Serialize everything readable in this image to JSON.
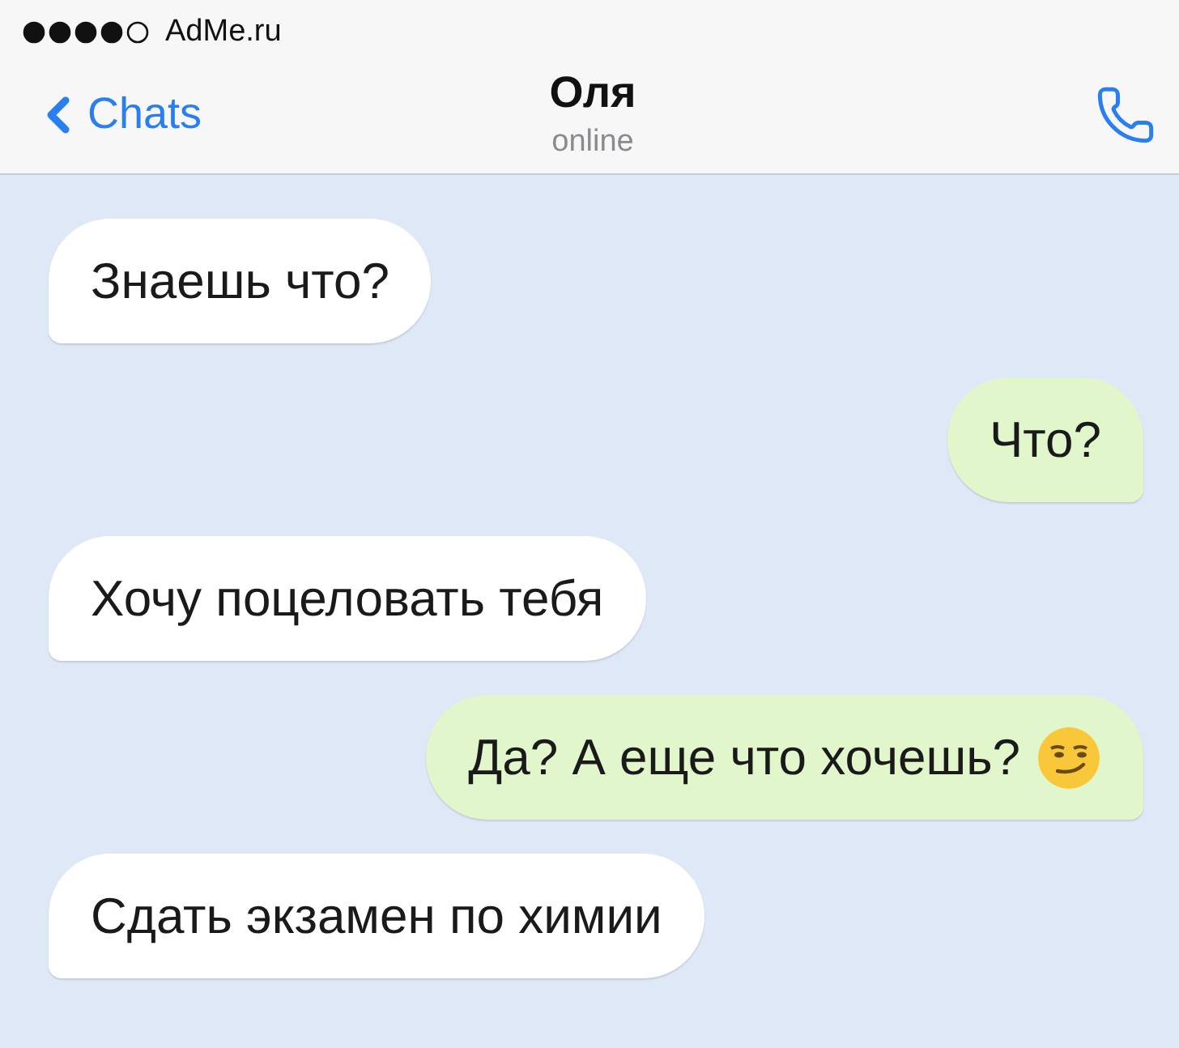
{
  "status_bar": {
    "signal_label": "AdMe.ru"
  },
  "header": {
    "back": "Chats",
    "title": "Оля",
    "subtitle": "online"
  },
  "messages": [
    {
      "kind": "incoming",
      "text": "Знаешь что?"
    },
    {
      "kind": "outgoing",
      "text": "Что?"
    },
    {
      "kind": "incoming",
      "text": "Хочу поцеловать тебя"
    },
    {
      "kind": "outgoing",
      "text": "Да? А еще что хочешь?",
      "emoji": true
    },
    {
      "kind": "incoming",
      "text": "Сдать экзамен по химии"
    }
  ]
}
